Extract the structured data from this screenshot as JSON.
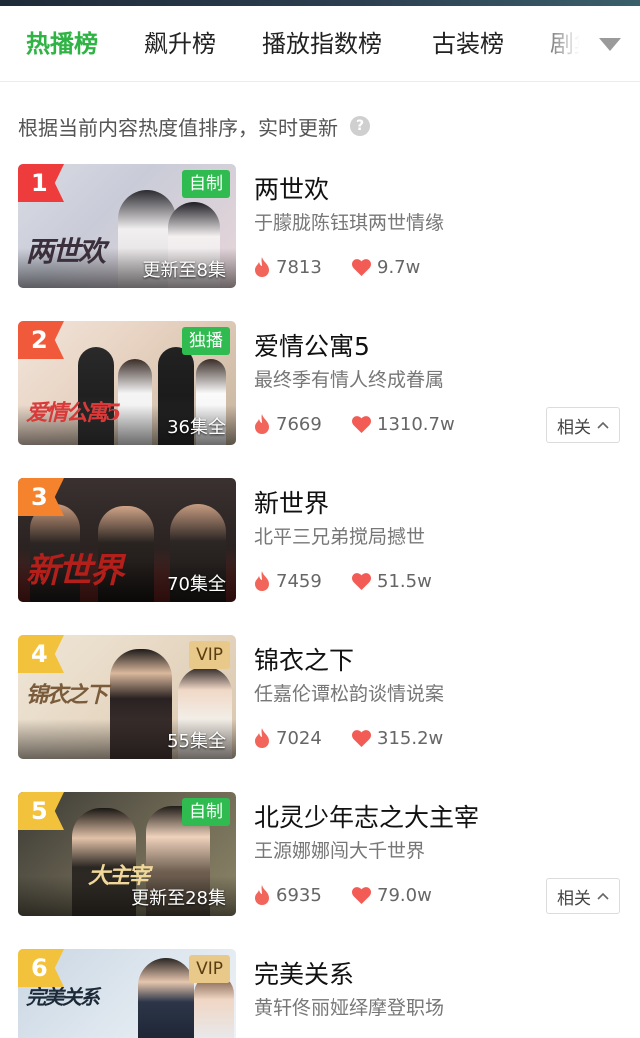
{
  "tabs": [
    {
      "label": "热播榜",
      "active": true
    },
    {
      "label": "飙升榜",
      "active": false
    },
    {
      "label": "播放指数榜",
      "active": false
    },
    {
      "label": "古装榜",
      "active": false
    },
    {
      "label": "剧集",
      "active": false
    }
  ],
  "description": "根据当前内容热度值排序，实时更新",
  "help_icon": "question-circle-icon",
  "related_label": "相关",
  "colors": {
    "accent": "#2fb344",
    "rank_1": "#ee3b3b",
    "rank_2": "#f05a3a",
    "rank_3": "#f5822d",
    "rank_other": "#f3c23c",
    "badge_green": "#2fbb4f",
    "badge_vip": "#e8c98a"
  },
  "items": [
    {
      "rank": "1",
      "badge": "自制",
      "badge_type": "green",
      "episodes": "更新至8集",
      "title": "两世欢",
      "subtitle": "于朦胧陈钰琪两世情缘",
      "heat": "7813",
      "likes": "9.7w",
      "poster_art": "两世欢",
      "show_related": false
    },
    {
      "rank": "2",
      "badge": "独播",
      "badge_type": "green",
      "episodes": "36集全",
      "title": "爱情公寓5",
      "subtitle": "最终季有情人终成眷属",
      "heat": "7669",
      "likes": "1310.7w",
      "poster_art": "爱情公寓5",
      "show_related": true
    },
    {
      "rank": "3",
      "badge": "",
      "badge_type": "none",
      "episodes": "70集全",
      "title": "新世界",
      "subtitle": "北平三兄弟搅局撼世",
      "heat": "7459",
      "likes": "51.5w",
      "poster_art": "新世界",
      "show_related": false
    },
    {
      "rank": "4",
      "badge": "VIP",
      "badge_type": "vip",
      "episodes": "55集全",
      "title": "锦衣之下",
      "subtitle": "任嘉伦谭松韵谈情说案",
      "heat": "7024",
      "likes": "315.2w",
      "poster_art": "锦衣之下",
      "show_related": false
    },
    {
      "rank": "5",
      "badge": "自制",
      "badge_type": "green",
      "episodes": "更新至28集",
      "title": "北灵少年志之大主宰",
      "subtitle": "王源娜娜闯大千世界",
      "heat": "6935",
      "likes": "79.0w",
      "poster_art": "大主宰",
      "show_related": true
    },
    {
      "rank": "6",
      "badge": "VIP",
      "badge_type": "vip",
      "episodes": "",
      "title": "完美关系",
      "subtitle": "黄轩佟丽娅绎摩登职场",
      "heat": "",
      "likes": "",
      "poster_art": "完美关系",
      "show_related": false
    }
  ]
}
